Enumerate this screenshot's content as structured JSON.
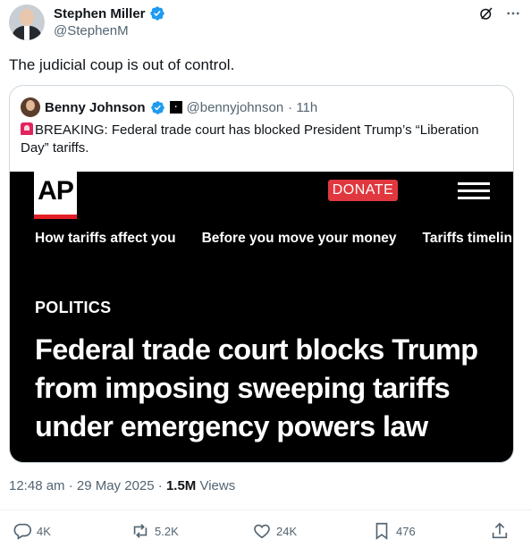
{
  "post": {
    "author_name": "Stephen Miller",
    "handle": "@StephenM",
    "text": "The judicial coup is out of control.",
    "timestamp": "12:48 am · 29 May 2025 · ",
    "views_count": "1.5M",
    "views_label": " Views"
  },
  "quote": {
    "author_name": "Benny Johnson",
    "handle": "@bennyjohnson",
    "time": "· 11h",
    "text": "BREAKING: Federal trade court has blocked President Trump’s “Liberation Day” tariffs."
  },
  "article": {
    "logo": "AP",
    "donate_label": "DONATE",
    "nav": [
      "How tariffs affect you",
      "Before you move your money",
      "Tariffs timelin"
    ],
    "section": "POLITICS",
    "headline": "Federal trade court blocks Trump from imposing sweeping tariffs under emergency powers law"
  },
  "actions": {
    "replies": "4K",
    "reposts": "5.2K",
    "likes": "24K",
    "bookmarks": "476"
  },
  "colors": {
    "verified": "#1d9bf0",
    "ap_red": "#e41e26",
    "donate": "#e0383e",
    "muted": "#536471"
  }
}
